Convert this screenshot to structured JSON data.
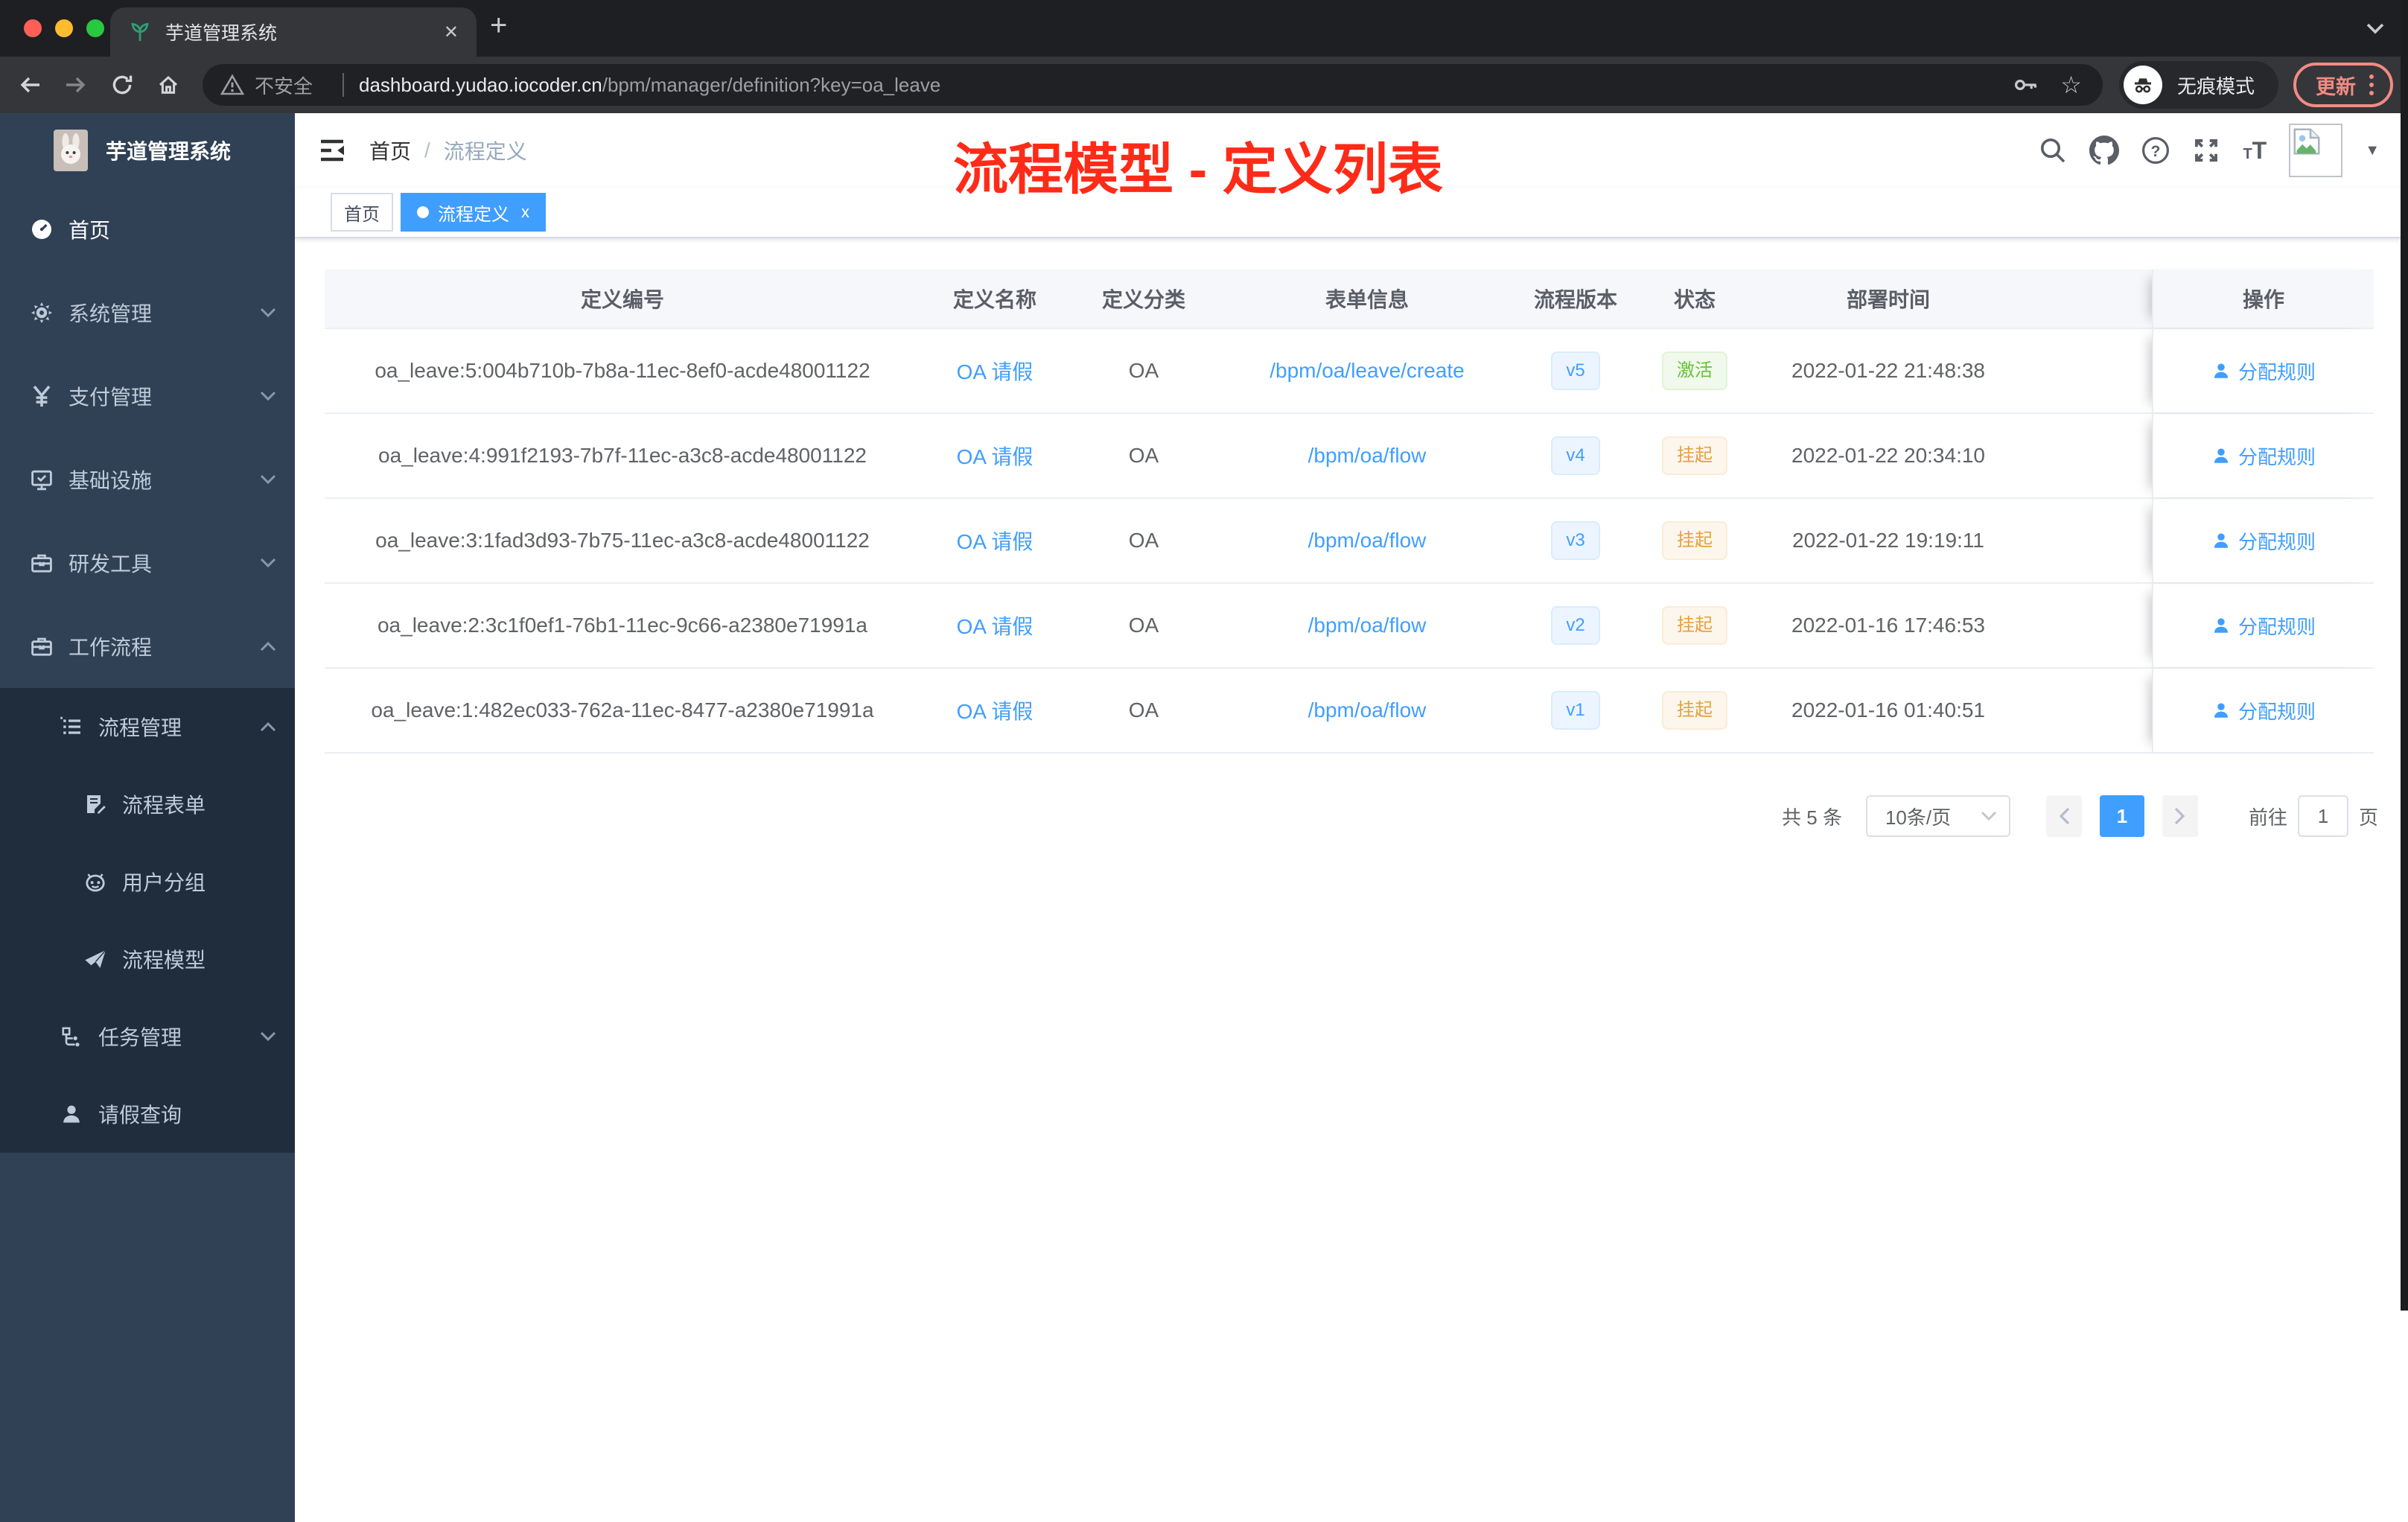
{
  "browser": {
    "tab": {
      "title": "芋道管理系统",
      "close_glyph": "✕"
    },
    "traffic_lights": {
      "red": "#ff5f57",
      "yellow": "#febc2e",
      "green": "#28c840"
    },
    "address": {
      "security_label": "不安全",
      "url_host": "dashboard.yudao.iocoder.cn",
      "url_path": "/bpm/manager/definition?key=oa_leave"
    },
    "incognito_label": "无痕模式",
    "update_label": "更新"
  },
  "sidebar": {
    "logo_title": "芋道管理系统",
    "items": [
      {
        "label": "首页",
        "icon": "dashboard",
        "active": true
      },
      {
        "label": "系统管理",
        "icon": "gear",
        "chev": "down"
      },
      {
        "label": "支付管理",
        "icon": "yen",
        "chev": "down"
      },
      {
        "label": "基础设施",
        "icon": "monitor",
        "chev": "down"
      },
      {
        "label": "研发工具",
        "icon": "toolbox",
        "chev": "down"
      },
      {
        "label": "工作流程",
        "icon": "briefcase",
        "chev": "up"
      }
    ],
    "submenu": [
      {
        "label": "流程管理",
        "icon": "treelist",
        "chev": "up",
        "level": 1
      },
      {
        "label": "流程表单",
        "icon": "formedit",
        "level": 2
      },
      {
        "label": "用户分组",
        "icon": "usergroup",
        "level": 2
      },
      {
        "label": "流程模型",
        "icon": "paperplane",
        "level": 2
      },
      {
        "label": "任务管理",
        "icon": "flowtree",
        "chev": "down",
        "level": 1
      },
      {
        "label": "请假查询",
        "icon": "person",
        "level": 1
      }
    ]
  },
  "navbar": {
    "breadcrumb": {
      "home": "首页",
      "separator": "/",
      "current": "流程定义"
    }
  },
  "annotation": {
    "title": "流程模型 - 定义列表",
    "color": "#fd2b18"
  },
  "tags": {
    "home": "首页",
    "active": "流程定义",
    "close_glyph": "x"
  },
  "table": {
    "columns": [
      "定义编号",
      "定义名称",
      "定义分类",
      "表单信息",
      "流程版本",
      "状态",
      "部署时间",
      "操作"
    ],
    "rows": [
      {
        "id": "oa_leave:5:004b710b-7b8a-11ec-8ef0-acde48001122",
        "name": "OA 请假",
        "category": "OA",
        "form": "/bpm/oa/leave/create",
        "version": "v5",
        "status": {
          "label": "激活",
          "type": "success"
        },
        "deploy_time": "2022-01-22 21:48:38",
        "action": "分配规则"
      },
      {
        "id": "oa_leave:4:991f2193-7b7f-11ec-a3c8-acde48001122",
        "name": "OA 请假",
        "category": "OA",
        "form": "/bpm/oa/flow",
        "version": "v4",
        "status": {
          "label": "挂起",
          "type": "warning"
        },
        "deploy_time": "2022-01-22 20:34:10",
        "action": "分配规则"
      },
      {
        "id": "oa_leave:3:1fad3d93-7b75-11ec-a3c8-acde48001122",
        "name": "OA 请假",
        "category": "OA",
        "form": "/bpm/oa/flow",
        "version": "v3",
        "status": {
          "label": "挂起",
          "type": "warning"
        },
        "deploy_time": "2022-01-22 19:19:11",
        "action": "分配规则"
      },
      {
        "id": "oa_leave:2:3c1f0ef1-76b1-11ec-9c66-a2380e71991a",
        "name": "OA 请假",
        "category": "OA",
        "form": "/bpm/oa/flow",
        "version": "v2",
        "status": {
          "label": "挂起",
          "type": "warning"
        },
        "deploy_time": "2022-01-16 17:46:53",
        "action": "分配规则"
      },
      {
        "id": "oa_leave:1:482ec033-762a-11ec-8477-a2380e71991a",
        "name": "OA 请假",
        "category": "OA",
        "form": "/bpm/oa/flow",
        "version": "v1",
        "status": {
          "label": "挂起",
          "type": "warning"
        },
        "deploy_time": "2022-01-16 01:40:51",
        "action": "分配规则"
      }
    ]
  },
  "pagination": {
    "total": "共 5 条",
    "page_size": "10条/页",
    "current_page": "1",
    "goto_label": "前往",
    "goto_value": "1",
    "page_suffix": "页"
  }
}
